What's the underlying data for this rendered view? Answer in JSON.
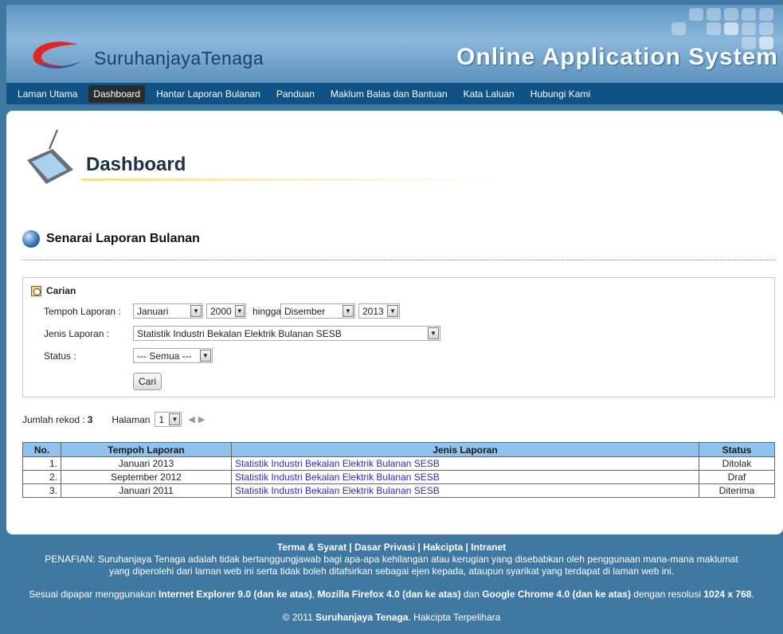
{
  "header": {
    "logo_text": "SuruhanjayaTenaga",
    "app_title": "Online Application System"
  },
  "nav": {
    "items": [
      "Laman Utama",
      "Dashboard",
      "Hantar Laporan Bulanan",
      "Panduan",
      "Maklum Balas dan Bantuan",
      "Kata Laluan",
      "Hubungi Kami"
    ],
    "active": "Dashboard"
  },
  "banner": {
    "title": "Dashboard"
  },
  "section": {
    "title": "Senarai Laporan Bulanan"
  },
  "search": {
    "title": "Carian",
    "tempoh_label": "Tempoh Laporan :",
    "bulan_mula": "Januari",
    "tahun_mula": "2000",
    "hingga": "hingga",
    "bulan_akhir": "Disember",
    "tahun_akhir": "2013",
    "jenis_label": "Jenis Laporan :",
    "jenis_value": "Statistik Industri Bekalan Elektrik Bulanan SESB",
    "status_label": "Status :",
    "status_value": "--- Semua ---",
    "button": "Cari"
  },
  "records": {
    "label": "Jumlah rekod :",
    "count": "3",
    "halaman_label": "Halaman",
    "halaman_value": "1"
  },
  "table": {
    "headers": [
      "No.",
      "Tempoh Laporan",
      "Jenis Laporan",
      "Status"
    ],
    "rows": [
      {
        "no": "1.",
        "tempoh": "Januari 2013",
        "jenis": "Statistik Industri Bekalan Elektrik Bulanan SESB",
        "status": "Ditolak"
      },
      {
        "no": "2.",
        "tempoh": "September 2012",
        "jenis": "Statistik Industri Bekalan Elektrik Bulanan SESB",
        "status": "Draf"
      },
      {
        "no": "3.",
        "tempoh": "Januari 2011",
        "jenis": "Statistik Industri Bekalan Elektrik Bulanan SESB",
        "status": "Diterima"
      }
    ]
  },
  "footer": {
    "links": [
      "Terma & Syarat",
      "Dasar Privasi",
      "Hakcipta",
      "Intranet"
    ],
    "disclaimer_1": "PENAFIAN: Suruhanjaya Tenaga adalah tidak bertanggungjawab bagi apa-apa kehilangan atau kerugian yang disebabkan oleh penggunaan mana-mana maklumat",
    "disclaimer_2": "yang diperolehi dari laman web ini serta tidak boleh ditafsirkan sebagai ejen kepada, ataupun syarikat yang terdapat di laman web ini.",
    "browser_pre": "Sesuai dipapar menggunakan",
    "ie": "Internet Explorer 9.0 (dan ke atas)",
    "ff": "Mozilla Firefox 4.0 (dan ke atas)",
    "dan": "dan",
    "chrome": "Google Chrome 4.0 (dan ke atas)",
    "res_pre": "dengan resolusi",
    "res": "1024 x 768",
    "copyright_pre": "© 2011",
    "copyright_org": "Suruhanjaya Tenaga",
    "copyright_post": ". Hakcipta Terpelihara"
  }
}
